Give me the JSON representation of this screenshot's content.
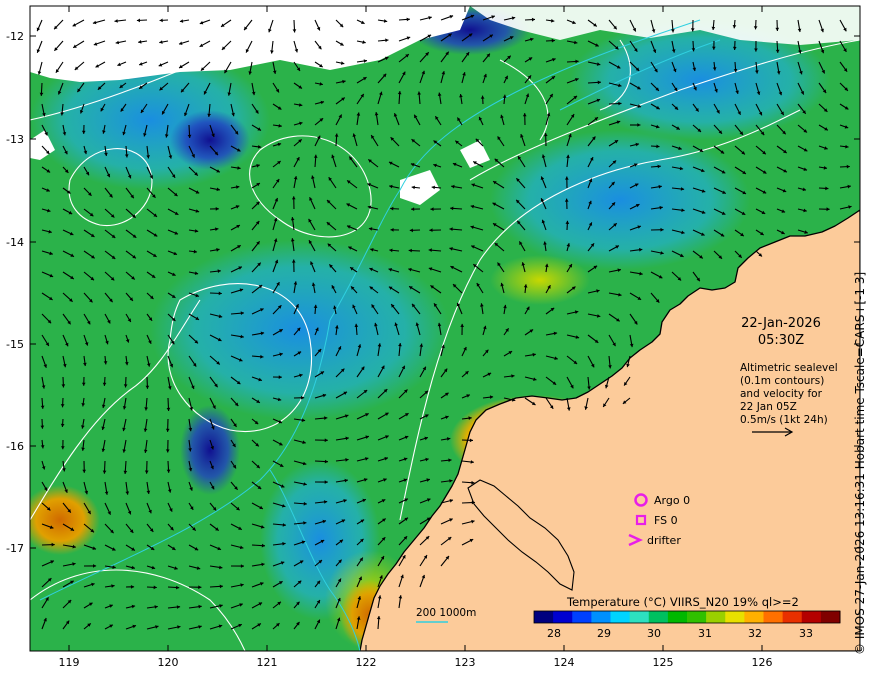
{
  "map": {
    "date": "22-Jan-2026",
    "time": "05:30Z",
    "altimetry_note": [
      "Altimetric sealevel",
      "(0.1m contours)",
      "and velocity for",
      "22 Jan 05Z",
      "0.5m/s (1kt 24h)"
    ],
    "lon_ticks": [
      "119",
      "120",
      "121",
      "122",
      "123",
      "124",
      "125",
      "126"
    ],
    "lat_ticks": [
      "-12",
      "-13",
      "-14",
      "-15",
      "-16",
      "-17"
    ],
    "legend": {
      "items": [
        {
          "label": "Argo 0",
          "symbol": "circle",
          "color": "#e81ee8"
        },
        {
          "label": "FS 0",
          "symbol": "square",
          "color": "#e81ee8"
        },
        {
          "label": "drifter",
          "symbol": "chevron",
          "color": "#e81ee8"
        }
      ]
    },
    "bathymetry_label": "200  1000m",
    "colorbar": {
      "title": "Temperature (°C) VIIRS_N20 19% ql>=2",
      "ticks": [
        "28",
        "29",
        "30",
        "31",
        "32",
        "33"
      ],
      "colors": [
        "#00007f",
        "#0000d0",
        "#0040ff",
        "#0090ff",
        "#00d4ff",
        "#2de0c0",
        "#00c060",
        "#00b800",
        "#30c000",
        "#9ad000",
        "#e8e000",
        "#ffb000",
        "#ff7000",
        "#e83000",
        "#b40000",
        "#800000"
      ]
    },
    "credit": "© IMOS 27-Jan-2026 13:16:31 Hobart time Tscale=CARS+[-1 3]",
    "colors": {
      "land": "#fccb9a",
      "contour": "#ffffff",
      "isobath": "#30d0e0",
      "coast": "#000000"
    }
  }
}
